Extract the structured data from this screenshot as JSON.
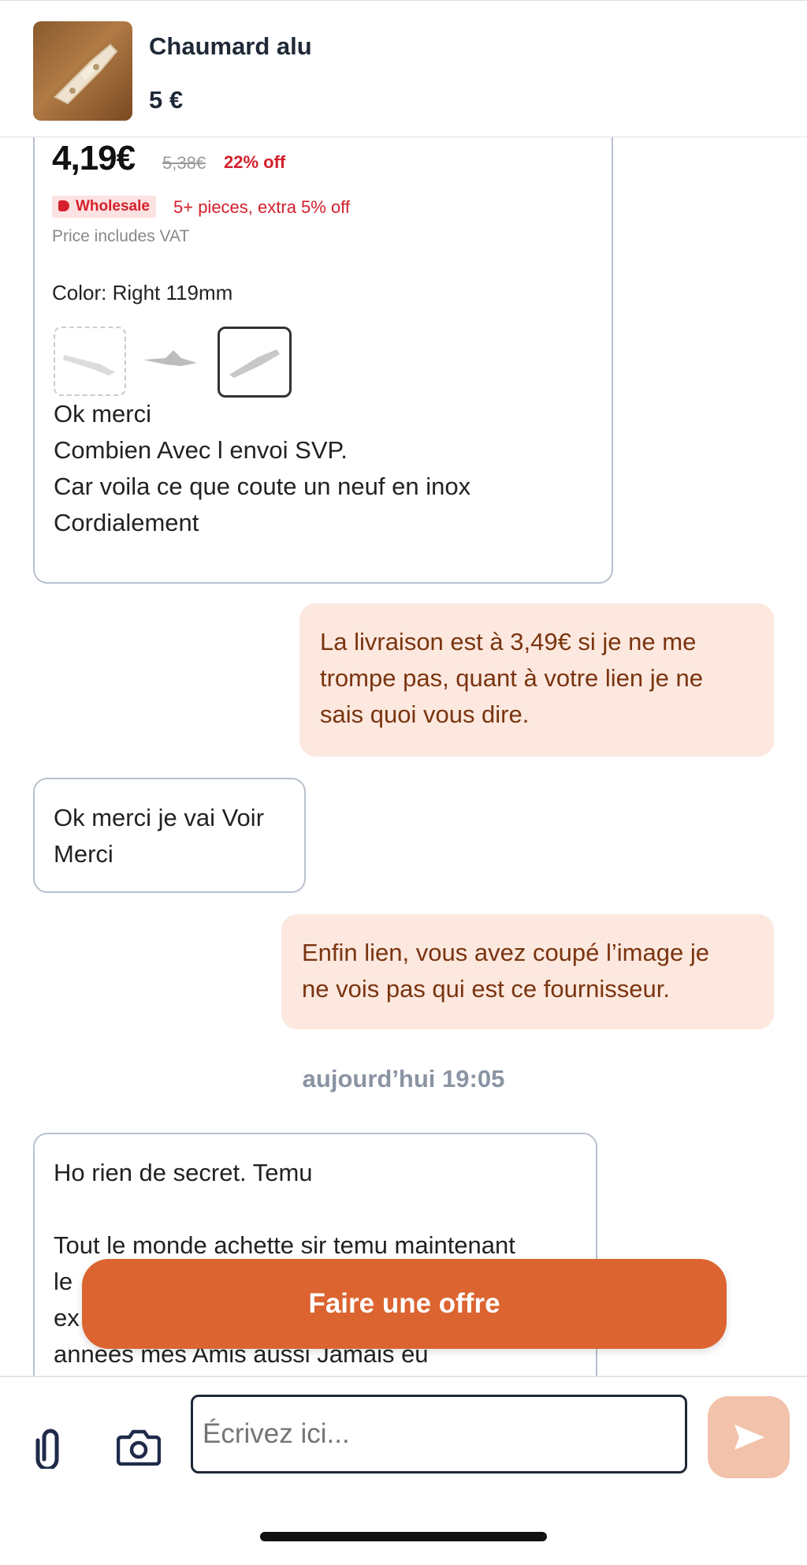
{
  "header": {
    "title": "Chaumard alu",
    "price": "5 €"
  },
  "image_card": {
    "price": "4,19€",
    "old_price": "5,38€",
    "discount": "22% off",
    "wholesale_badge": "Wholesale",
    "wholesale_text": "5+ pieces, extra 5% off",
    "vat_note": "Price includes VAT",
    "color_label": "Color: Right 119mm",
    "text_lines": [
      "Ok merci",
      "Combien Avec l envoi SVP.",
      "Car voila ce que coute un neuf en inox",
      "Cordialement"
    ]
  },
  "messages": [
    {
      "side": "right",
      "lines": [
        "La livraison est à 3,49€ si je ne me",
        "trompe pas, quant à votre lien je ne",
        "sais quoi vous dire."
      ]
    },
    {
      "side": "left",
      "lines": [
        "Ok merci je vai Voir",
        "Merci"
      ]
    },
    {
      "side": "right",
      "lines": [
        "Enfin lien, vous avez coupé l’image je",
        "ne vois pas qui est ce fournisseur."
      ]
    }
  ],
  "timestamp": "aujourd’hui 19:05",
  "last_message": {
    "lines": [
      "Ho rien de secret.  Temu",
      "",
      "Tout le monde achette sir temu maintenant",
      "le",
      "ex",
      "annees mes Amis aussi  Jamais eu"
    ]
  },
  "offer_button": "Faire une offre",
  "composer": {
    "placeholder": "Écrivez ici..."
  },
  "colors": {
    "accent": "#db6430",
    "bubble_right": "#fce8de",
    "send_button": "#f3c2aa"
  },
  "icons": [
    "paperclip-icon",
    "camera-icon",
    "send-icon"
  ]
}
